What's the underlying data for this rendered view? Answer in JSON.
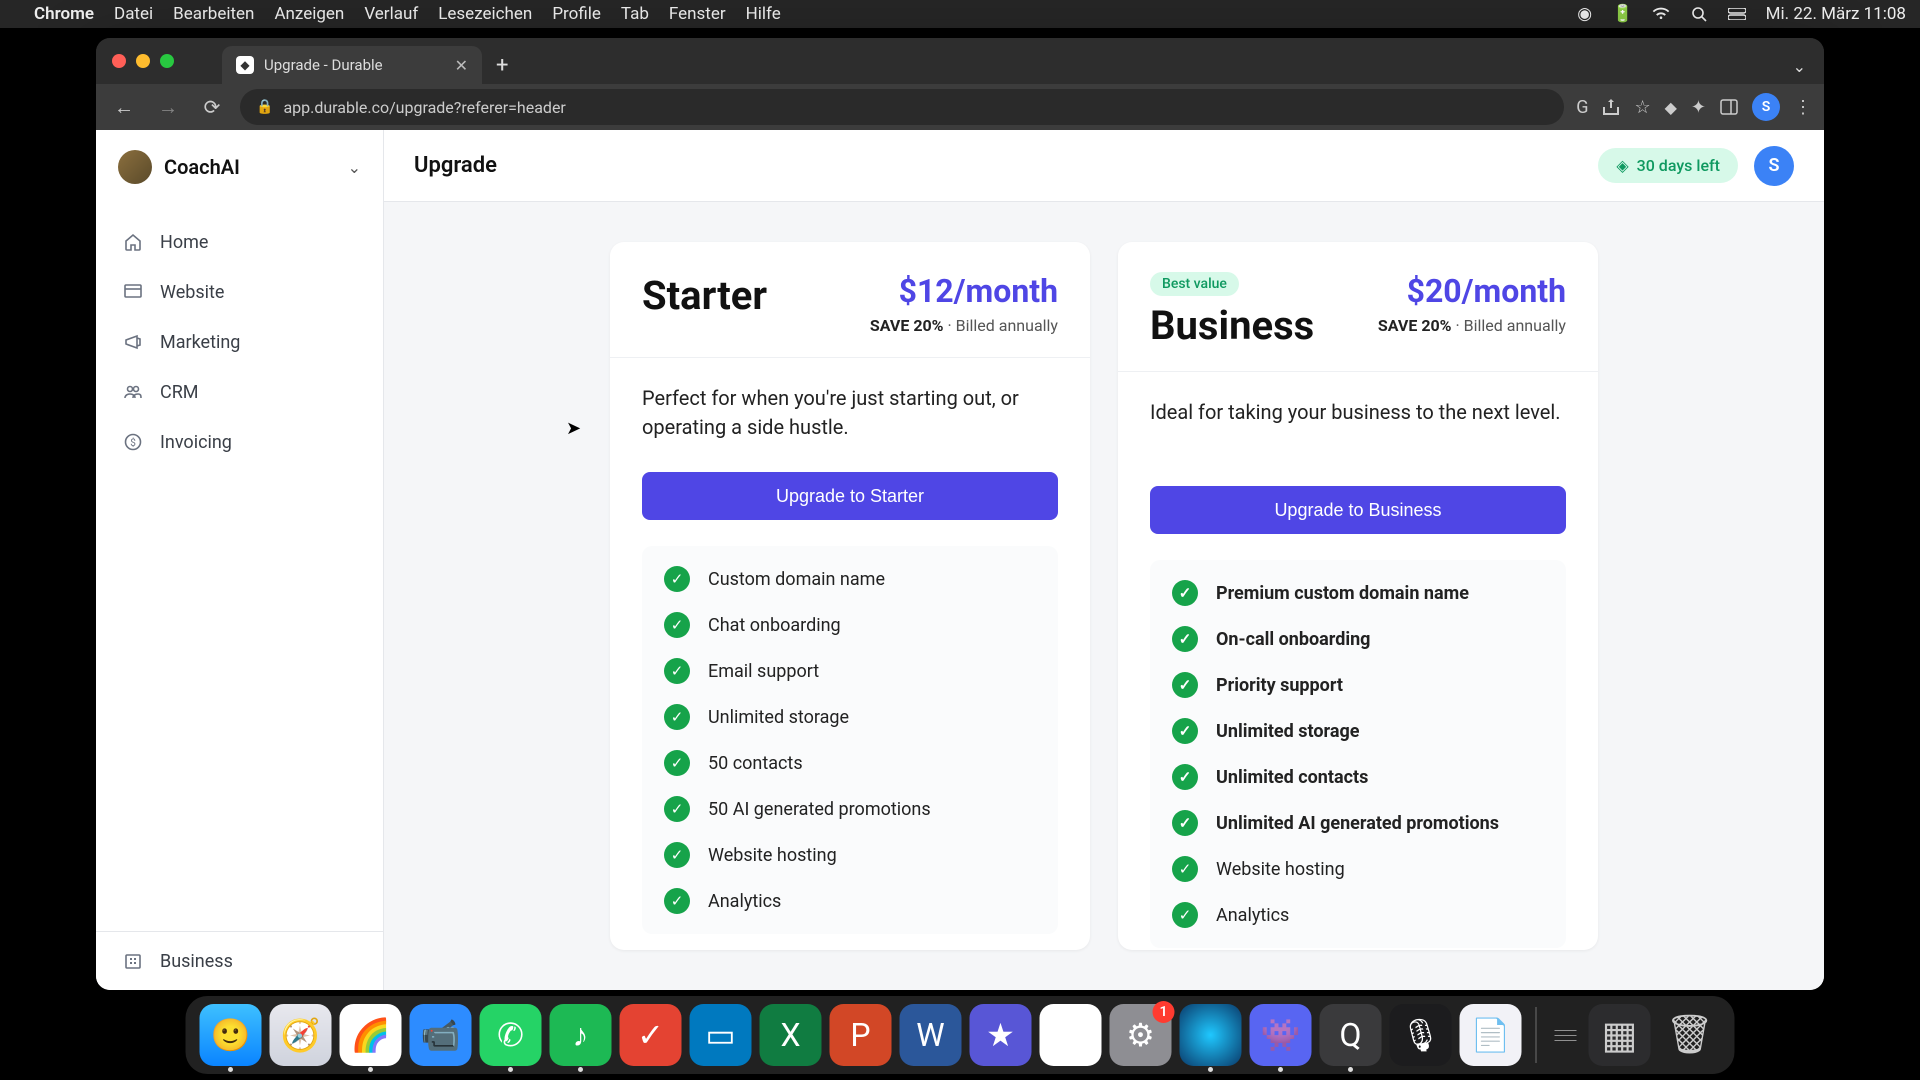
{
  "menubar": {
    "app": "Chrome",
    "items": [
      "Datei",
      "Bearbeiten",
      "Anzeigen",
      "Verlauf",
      "Lesezeichen",
      "Profile",
      "Tab",
      "Fenster",
      "Hilfe"
    ],
    "datetime": "Mi. 22. März  11:08"
  },
  "browser": {
    "tab_title": "Upgrade - Durable",
    "url": "app.durable.co/upgrade?referer=header",
    "avatar_letter": "S"
  },
  "app": {
    "workspace": "CoachAI",
    "page_title": "Upgrade",
    "trial": "30 days left",
    "user_initial": "S",
    "sidebar": [
      {
        "icon": "home",
        "label": "Home"
      },
      {
        "icon": "website",
        "label": "Website"
      },
      {
        "icon": "marketing",
        "label": "Marketing"
      },
      {
        "icon": "crm",
        "label": "CRM"
      },
      {
        "icon": "invoicing",
        "label": "Invoicing"
      }
    ],
    "sidebar_footer": {
      "icon": "business",
      "label": "Business"
    },
    "plans": [
      {
        "id": "starter",
        "name": "Starter",
        "price": "$12/month",
        "save": "SAVE 20%",
        "billing": "Billed annually",
        "badge": null,
        "desc": "Perfect for when you're just starting out, or operating a side hustle.",
        "cta": "Upgrade to Starter",
        "features": [
          {
            "text": "Custom domain name",
            "bold": false
          },
          {
            "text": "Chat onboarding",
            "bold": false
          },
          {
            "text": "Email support",
            "bold": false
          },
          {
            "text": "Unlimited storage",
            "bold": false
          },
          {
            "text": "50 contacts",
            "bold": false
          },
          {
            "text": "50 AI generated promotions",
            "bold": false
          },
          {
            "text": "Website hosting",
            "bold": false
          },
          {
            "text": "Analytics",
            "bold": false
          }
        ]
      },
      {
        "id": "business",
        "name": "Business",
        "price": "$20/month",
        "save": "SAVE 20%",
        "billing": "Billed annually",
        "badge": "Best value",
        "desc": "Ideal for taking your business to the next level.",
        "cta": "Upgrade to Business",
        "features": [
          {
            "text": "Premium custom domain name",
            "bold": true
          },
          {
            "text": "On-call onboarding",
            "bold": true
          },
          {
            "text": "Priority support",
            "bold": true
          },
          {
            "text": "Unlimited storage",
            "bold": true
          },
          {
            "text": "Unlimited contacts",
            "bold": true
          },
          {
            "text": "Unlimited AI generated promotions",
            "bold": true
          },
          {
            "text": "Website hosting",
            "bold": false
          },
          {
            "text": "Analytics",
            "bold": false
          }
        ]
      }
    ]
  },
  "dock": {
    "apps": [
      {
        "name": "finder",
        "bg": "linear-gradient(#3ec0ff,#0a84ff)",
        "glyph": "🙂",
        "running": true
      },
      {
        "name": "safari",
        "bg": "linear-gradient(#e8e8ee,#cfd3dd)",
        "glyph": "🧭",
        "running": false
      },
      {
        "name": "chrome",
        "bg": "#fff",
        "glyph": "🌈",
        "running": true
      },
      {
        "name": "zoom",
        "bg": "#2d8cff",
        "glyph": "📹",
        "running": false
      },
      {
        "name": "whatsapp",
        "bg": "#25d366",
        "glyph": "✆",
        "running": true
      },
      {
        "name": "spotify",
        "bg": "#1db954",
        "glyph": "♪",
        "running": true
      },
      {
        "name": "todoist",
        "bg": "#e44332",
        "glyph": "✓",
        "running": false
      },
      {
        "name": "trello",
        "bg": "#0079bf",
        "glyph": "▭",
        "running": false
      },
      {
        "name": "excel",
        "bg": "#107c41",
        "glyph": "X",
        "running": false
      },
      {
        "name": "powerpoint",
        "bg": "#d24726",
        "glyph": "P",
        "running": false
      },
      {
        "name": "word",
        "bg": "#2b579a",
        "glyph": "W",
        "running": false
      },
      {
        "name": "imovie",
        "bg": "#5856d6",
        "glyph": "★",
        "running": false
      },
      {
        "name": "drive",
        "bg": "#fff",
        "glyph": "▲",
        "running": false
      },
      {
        "name": "settings",
        "bg": "#8e8e93",
        "glyph": "⚙",
        "running": false,
        "badge": "1"
      },
      {
        "name": "siri",
        "bg": "radial-gradient(circle,#1fc8ff,#0a3a6a)",
        "glyph": "",
        "running": true
      },
      {
        "name": "discord",
        "bg": "#5865f2",
        "glyph": "👾",
        "running": true
      },
      {
        "name": "quicktime",
        "bg": "#3a3a3c",
        "glyph": "Q",
        "running": true
      },
      {
        "name": "voice-memos",
        "bg": "#1c1c1e",
        "glyph": "🎙",
        "running": false
      },
      {
        "name": "file",
        "bg": "#f2f2f7",
        "glyph": "📄",
        "running": false
      }
    ],
    "right": [
      {
        "name": "stacks",
        "bg": "#2c2c2e",
        "glyph": "▦"
      },
      {
        "name": "trash",
        "bg": "transparent",
        "glyph": "🗑"
      }
    ]
  }
}
